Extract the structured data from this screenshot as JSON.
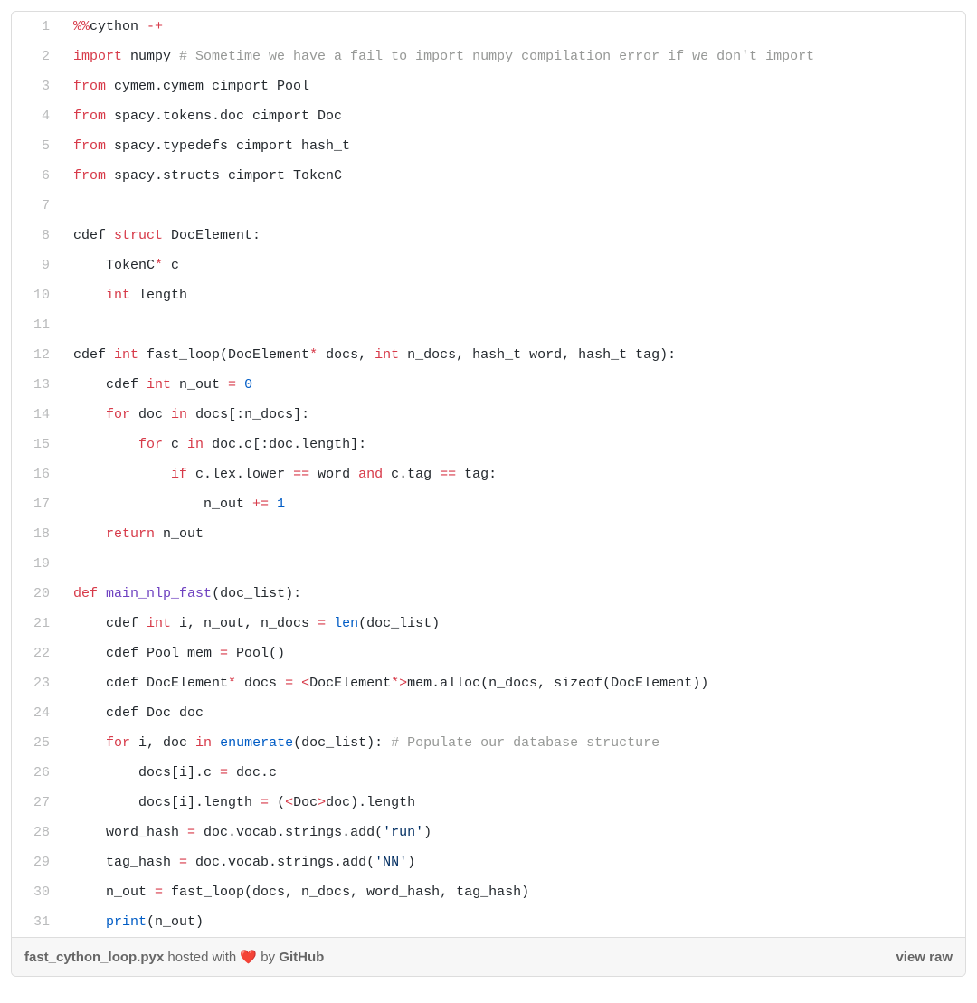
{
  "filename": "fast_cython_loop.pyx",
  "hosted_with_prefix": " hosted with ",
  "heart": "❤️",
  "by_text": " by ",
  "host": "GitHub",
  "view_raw": "view raw",
  "lines": [
    {
      "n": 1,
      "tokens": [
        {
          "t": "%%",
          "c": "o"
        },
        {
          "t": "cython ",
          "c": ""
        },
        {
          "t": "-+",
          "c": "o"
        }
      ]
    },
    {
      "n": 2,
      "tokens": [
        {
          "t": "import",
          "c": "k"
        },
        {
          "t": " numpy ",
          "c": ""
        },
        {
          "t": "# Sometime we have a fail to import numpy compilation error if we don't import",
          "c": "c"
        }
      ]
    },
    {
      "n": 3,
      "tokens": [
        {
          "t": "from",
          "c": "k"
        },
        {
          "t": " cymem.cymem cimport Pool",
          "c": ""
        }
      ]
    },
    {
      "n": 4,
      "tokens": [
        {
          "t": "from",
          "c": "k"
        },
        {
          "t": " spacy.tokens.doc cimport Doc",
          "c": ""
        }
      ]
    },
    {
      "n": 5,
      "tokens": [
        {
          "t": "from",
          "c": "k"
        },
        {
          "t": " spacy.typedefs cimport hash_t",
          "c": ""
        }
      ]
    },
    {
      "n": 6,
      "tokens": [
        {
          "t": "from",
          "c": "k"
        },
        {
          "t": " spacy.structs cimport TokenC",
          "c": ""
        }
      ]
    },
    {
      "n": 7,
      "tokens": [
        {
          "t": "",
          "c": ""
        }
      ]
    },
    {
      "n": 8,
      "tokens": [
        {
          "t": "cdef ",
          "c": ""
        },
        {
          "t": "struct",
          "c": "k"
        },
        {
          "t": " DocElement:",
          "c": ""
        }
      ]
    },
    {
      "n": 9,
      "tokens": [
        {
          "t": "    TokenC",
          "c": ""
        },
        {
          "t": "*",
          "c": "o"
        },
        {
          "t": " c",
          "c": ""
        }
      ]
    },
    {
      "n": 10,
      "tokens": [
        {
          "t": "    ",
          "c": ""
        },
        {
          "t": "int",
          "c": "k"
        },
        {
          "t": " length",
          "c": ""
        }
      ]
    },
    {
      "n": 11,
      "tokens": [
        {
          "t": "",
          "c": ""
        }
      ]
    },
    {
      "n": 12,
      "tokens": [
        {
          "t": "cdef ",
          "c": ""
        },
        {
          "t": "int",
          "c": "k"
        },
        {
          "t": " fast_loop(DocElement",
          "c": ""
        },
        {
          "t": "*",
          "c": "o"
        },
        {
          "t": " docs, ",
          "c": ""
        },
        {
          "t": "int",
          "c": "k"
        },
        {
          "t": " n_docs, hash_t word, hash_t tag):",
          "c": ""
        }
      ]
    },
    {
      "n": 13,
      "tokens": [
        {
          "t": "    cdef ",
          "c": ""
        },
        {
          "t": "int",
          "c": "k"
        },
        {
          "t": " n_out ",
          "c": ""
        },
        {
          "t": "=",
          "c": "o"
        },
        {
          "t": " ",
          "c": ""
        },
        {
          "t": "0",
          "c": "mi"
        }
      ]
    },
    {
      "n": 14,
      "tokens": [
        {
          "t": "    ",
          "c": ""
        },
        {
          "t": "for",
          "c": "k"
        },
        {
          "t": " doc ",
          "c": ""
        },
        {
          "t": "in",
          "c": "k"
        },
        {
          "t": " docs[:n_docs]:",
          "c": ""
        }
      ]
    },
    {
      "n": 15,
      "tokens": [
        {
          "t": "        ",
          "c": ""
        },
        {
          "t": "for",
          "c": "k"
        },
        {
          "t": " c ",
          "c": ""
        },
        {
          "t": "in",
          "c": "k"
        },
        {
          "t": " doc.c[:doc.length]:",
          "c": ""
        }
      ]
    },
    {
      "n": 16,
      "tokens": [
        {
          "t": "            ",
          "c": ""
        },
        {
          "t": "if",
          "c": "k"
        },
        {
          "t": " c.lex.lower ",
          "c": ""
        },
        {
          "t": "==",
          "c": "o"
        },
        {
          "t": " word ",
          "c": ""
        },
        {
          "t": "and",
          "c": "k"
        },
        {
          "t": " c.tag ",
          "c": ""
        },
        {
          "t": "==",
          "c": "o"
        },
        {
          "t": " tag:",
          "c": ""
        }
      ]
    },
    {
      "n": 17,
      "tokens": [
        {
          "t": "                n_out ",
          "c": ""
        },
        {
          "t": "+=",
          "c": "o"
        },
        {
          "t": " ",
          "c": ""
        },
        {
          "t": "1",
          "c": "mi"
        }
      ]
    },
    {
      "n": 18,
      "tokens": [
        {
          "t": "    ",
          "c": ""
        },
        {
          "t": "return",
          "c": "k"
        },
        {
          "t": " n_out",
          "c": ""
        }
      ]
    },
    {
      "n": 19,
      "tokens": [
        {
          "t": "",
          "c": ""
        }
      ]
    },
    {
      "n": 20,
      "tokens": [
        {
          "t": "def",
          "c": "k"
        },
        {
          "t": " ",
          "c": ""
        },
        {
          "t": "main_nlp_fast",
          "c": "nf"
        },
        {
          "t": "(doc_list):",
          "c": ""
        }
      ]
    },
    {
      "n": 21,
      "tokens": [
        {
          "t": "    cdef ",
          "c": ""
        },
        {
          "t": "int",
          "c": "k"
        },
        {
          "t": " i, n_out, n_docs ",
          "c": ""
        },
        {
          "t": "=",
          "c": "o"
        },
        {
          "t": " ",
          "c": ""
        },
        {
          "t": "len",
          "c": "nb"
        },
        {
          "t": "(doc_list)",
          "c": ""
        }
      ]
    },
    {
      "n": 22,
      "tokens": [
        {
          "t": "    cdef Pool mem ",
          "c": ""
        },
        {
          "t": "=",
          "c": "o"
        },
        {
          "t": " Pool()",
          "c": ""
        }
      ]
    },
    {
      "n": 23,
      "tokens": [
        {
          "t": "    cdef DocElement",
          "c": ""
        },
        {
          "t": "*",
          "c": "o"
        },
        {
          "t": " docs ",
          "c": ""
        },
        {
          "t": "=",
          "c": "o"
        },
        {
          "t": " ",
          "c": ""
        },
        {
          "t": "<",
          "c": "o"
        },
        {
          "t": "DocElement",
          "c": ""
        },
        {
          "t": "*>",
          "c": "o"
        },
        {
          "t": "mem.alloc(n_docs, sizeof(DocElement))",
          "c": ""
        }
      ]
    },
    {
      "n": 24,
      "tokens": [
        {
          "t": "    cdef Doc doc",
          "c": ""
        }
      ]
    },
    {
      "n": 25,
      "tokens": [
        {
          "t": "    ",
          "c": ""
        },
        {
          "t": "for",
          "c": "k"
        },
        {
          "t": " i, doc ",
          "c": ""
        },
        {
          "t": "in",
          "c": "k"
        },
        {
          "t": " ",
          "c": ""
        },
        {
          "t": "enumerate",
          "c": "nb"
        },
        {
          "t": "(doc_list): ",
          "c": ""
        },
        {
          "t": "# Populate our database structure",
          "c": "c"
        }
      ]
    },
    {
      "n": 26,
      "tokens": [
        {
          "t": "        docs[i].c ",
          "c": ""
        },
        {
          "t": "=",
          "c": "o"
        },
        {
          "t": " doc.c",
          "c": ""
        }
      ]
    },
    {
      "n": 27,
      "tokens": [
        {
          "t": "        docs[i].length ",
          "c": ""
        },
        {
          "t": "=",
          "c": "o"
        },
        {
          "t": " (",
          "c": ""
        },
        {
          "t": "<",
          "c": "o"
        },
        {
          "t": "Doc",
          "c": ""
        },
        {
          "t": ">",
          "c": "o"
        },
        {
          "t": "doc).length",
          "c": ""
        }
      ]
    },
    {
      "n": 28,
      "tokens": [
        {
          "t": "    word_hash ",
          "c": ""
        },
        {
          "t": "=",
          "c": "o"
        },
        {
          "t": " doc.vocab.strings.add(",
          "c": ""
        },
        {
          "t": "'run'",
          "c": "s"
        },
        {
          "t": ")",
          "c": ""
        }
      ]
    },
    {
      "n": 29,
      "tokens": [
        {
          "t": "    tag_hash ",
          "c": ""
        },
        {
          "t": "=",
          "c": "o"
        },
        {
          "t": " doc.vocab.strings.add(",
          "c": ""
        },
        {
          "t": "'NN'",
          "c": "s"
        },
        {
          "t": ")",
          "c": ""
        }
      ]
    },
    {
      "n": 30,
      "tokens": [
        {
          "t": "    n_out ",
          "c": ""
        },
        {
          "t": "=",
          "c": "o"
        },
        {
          "t": " fast_loop(docs, n_docs, word_hash, tag_hash)",
          "c": ""
        }
      ]
    },
    {
      "n": 31,
      "tokens": [
        {
          "t": "    ",
          "c": ""
        },
        {
          "t": "print",
          "c": "nb"
        },
        {
          "t": "(n_out)",
          "c": ""
        }
      ]
    }
  ]
}
